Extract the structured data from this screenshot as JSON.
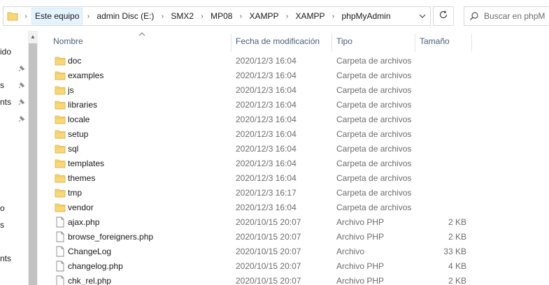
{
  "address_bar": {
    "crumbs": [
      "Este equipo",
      "admin Disc (E:)",
      "SMX2",
      "MP08",
      "XAMPP",
      "XAMPP",
      "phpMyAdmin"
    ]
  },
  "search": {
    "placeholder": "Buscar en phpM"
  },
  "nav": {
    "items": [
      "ido",
      "s",
      "nts",
      "",
      "o",
      "s",
      "nts"
    ]
  },
  "columns": {
    "name": "Nombre",
    "date": "Fecha de modificación",
    "type": "Tipo",
    "size": "Tamaño"
  },
  "files": [
    {
      "name": "doc",
      "date": "2020/12/3 16:04",
      "type": "Carpeta de archivos",
      "size": "",
      "icon": "folder-icon"
    },
    {
      "name": "examples",
      "date": "2020/12/3 16:04",
      "type": "Carpeta de archivos",
      "size": "",
      "icon": "folder-icon"
    },
    {
      "name": "js",
      "date": "2020/12/3 16:04",
      "type": "Carpeta de archivos",
      "size": "",
      "icon": "folder-icon"
    },
    {
      "name": "libraries",
      "date": "2020/12/3 16:04",
      "type": "Carpeta de archivos",
      "size": "",
      "icon": "folder-icon"
    },
    {
      "name": "locale",
      "date": "2020/12/3 16:04",
      "type": "Carpeta de archivos",
      "size": "",
      "icon": "folder-icon"
    },
    {
      "name": "setup",
      "date": "2020/12/3 16:04",
      "type": "Carpeta de archivos",
      "size": "",
      "icon": "folder-icon"
    },
    {
      "name": "sql",
      "date": "2020/12/3 16:04",
      "type": "Carpeta de archivos",
      "size": "",
      "icon": "folder-icon"
    },
    {
      "name": "templates",
      "date": "2020/12/3 16:04",
      "type": "Carpeta de archivos",
      "size": "",
      "icon": "folder-icon"
    },
    {
      "name": "themes",
      "date": "2020/12/3 16:04",
      "type": "Carpeta de archivos",
      "size": "",
      "icon": "folder-icon"
    },
    {
      "name": "tmp",
      "date": "2020/12/3 16:17",
      "type": "Carpeta de archivos",
      "size": "",
      "icon": "folder-icon"
    },
    {
      "name": "vendor",
      "date": "2020/12/3 16:04",
      "type": "Carpeta de archivos",
      "size": "",
      "icon": "folder-icon"
    },
    {
      "name": "ajax.php",
      "date": "2020/10/15 20:07",
      "type": "Archivo PHP",
      "size": "2 KB",
      "icon": "file-icon"
    },
    {
      "name": "browse_foreigners.php",
      "date": "2020/10/15 20:07",
      "type": "Archivo PHP",
      "size": "2 KB",
      "icon": "file-icon"
    },
    {
      "name": "ChangeLog",
      "date": "2020/10/15 20:07",
      "type": "Archivo",
      "size": "33 KB",
      "icon": "file-icon"
    },
    {
      "name": "changelog.php",
      "date": "2020/10/15 20:07",
      "type": "Archivo PHP",
      "size": "4 KB",
      "icon": "file-icon"
    },
    {
      "name": "chk_rel.php",
      "date": "2020/10/15 20:07",
      "type": "Archivo PHP",
      "size": "2 KB",
      "icon": "file-icon"
    }
  ],
  "colors": {
    "folder": "#f8d775",
    "header_text": "#4c607a",
    "meta_text": "#6d6d6d"
  }
}
